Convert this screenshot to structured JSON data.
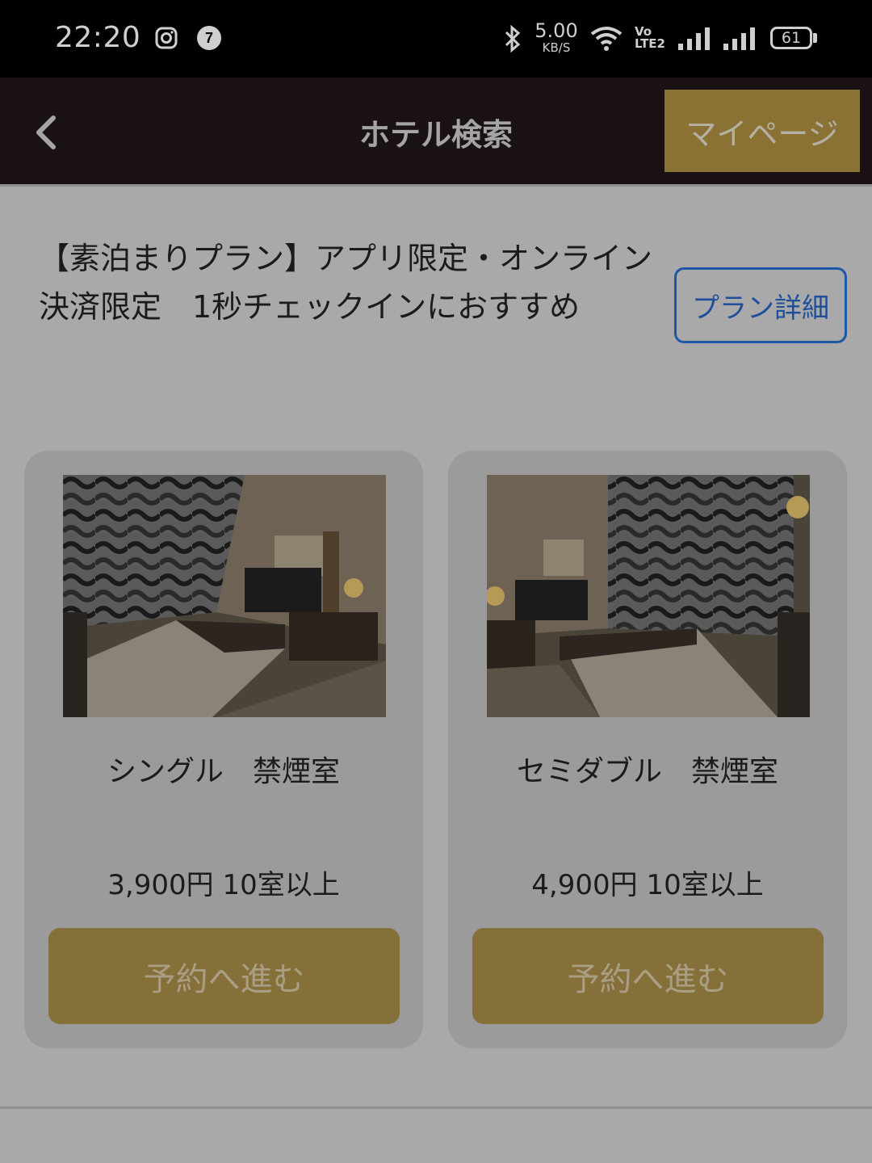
{
  "status_bar": {
    "time": "22:20",
    "speed_value": "5.00",
    "speed_unit": "KB/S",
    "volte": "Vo",
    "lte": "LTE2",
    "battery": "61",
    "icons": [
      "instagram-icon",
      "seven-eleven-icon",
      "bluetooth-icon",
      "wifi-icon",
      "signal-icon",
      "signal-icon",
      "battery-icon"
    ]
  },
  "header": {
    "title": "ホテル検索",
    "mypage_label": "マイページ",
    "back_icon": "chevron-left-icon"
  },
  "plan": {
    "title": "【素泊まりプラン】アプリ限定・オンライン決済限定　1秒チェックインにおすすめ",
    "detail_button": "プラン詳細"
  },
  "rooms": [
    {
      "name": "シングル　禁煙室",
      "price_text": "3,900円 10室以上",
      "reserve_label": "予約へ進む"
    },
    {
      "name": "セミダブル　禁煙室",
      "price_text": "4,900円 10室以上",
      "reserve_label": "予約へ進む"
    }
  ],
  "colors": {
    "header_bg": "#1a1212",
    "gold_button": "#85703a",
    "link_blue": "#1f57a8",
    "page_bg": "#a9a9a9"
  }
}
